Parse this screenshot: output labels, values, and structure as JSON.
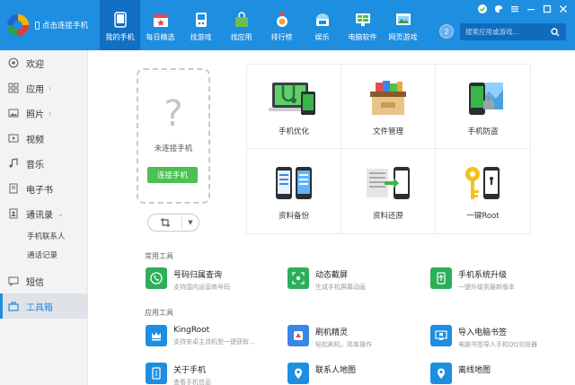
{
  "brand": {
    "label": "点击连接手机"
  },
  "nav": {
    "items": [
      {
        "label": "我的手机",
        "icon": "phone-icon"
      },
      {
        "label": "每日精选",
        "icon": "calendar-icon"
      },
      {
        "label": "找游戏",
        "icon": "gamepad-icon"
      },
      {
        "label": "找应用",
        "icon": "shopping-bag-icon"
      },
      {
        "label": "排行榜",
        "icon": "medal-icon"
      },
      {
        "label": "娱乐",
        "icon": "entertainment-icon"
      },
      {
        "label": "电脑软件",
        "icon": "monitor-icon"
      },
      {
        "label": "网页游戏",
        "icon": "web-game-icon"
      }
    ],
    "badge": "2"
  },
  "search": {
    "placeholder": "搜索应用或游戏..."
  },
  "sidebar": {
    "items": [
      {
        "label": "欢迎",
        "icon": "welcome-icon"
      },
      {
        "label": "应用",
        "icon": "apps-grid-icon"
      },
      {
        "label": "照片",
        "icon": "photo-icon"
      },
      {
        "label": "视频",
        "icon": "video-icon"
      },
      {
        "label": "音乐",
        "icon": "music-icon"
      },
      {
        "label": "电子书",
        "icon": "book-icon"
      },
      {
        "label": "通讯录",
        "icon": "contacts-icon"
      },
      {
        "label": "短信",
        "icon": "sms-icon"
      },
      {
        "label": "工具箱",
        "icon": "toolbox-icon"
      }
    ],
    "sub_items": [
      "手机联系人",
      "通话记录"
    ]
  },
  "device": {
    "status": "未连接手机",
    "connect_label": "连接手机"
  },
  "features": [
    {
      "label": "手机优化",
      "icon": "optimize-icon"
    },
    {
      "label": "文件管理",
      "icon": "file-manager-icon"
    },
    {
      "label": "手机防盗",
      "icon": "anti-theft-icon"
    },
    {
      "label": "资料备份",
      "icon": "backup-icon"
    },
    {
      "label": "资料还原",
      "icon": "restore-icon"
    },
    {
      "label": "一键Root",
      "icon": "root-key-icon"
    }
  ],
  "sections": {
    "common": "常用工具",
    "apps": "应用工具"
  },
  "common_tools": [
    {
      "name": "号码归属查询",
      "desc": "支持国内运营商号码",
      "color": "#2eae5a"
    },
    {
      "name": "动态截屏",
      "desc": "生成手机屏幕动画",
      "color": "#2eae5a"
    },
    {
      "name": "手机系统升级",
      "desc": "一键升级到最新版本",
      "color": "#2eae5a"
    }
  ],
  "app_tools": [
    {
      "name": "KingRoot",
      "desc": "支持安卓主流机型一键获取...",
      "color": "#1e8ee0"
    },
    {
      "name": "刷机精灵",
      "desc": "轻松刷机，简单操作",
      "color": "#3a87e8"
    },
    {
      "name": "导入电脑书签",
      "desc": "电脑书签导入手机QQ浏览器",
      "color": "#1e8ee0"
    },
    {
      "name": "关于手机",
      "desc": "查看手机信息",
      "color": "#1e8ee0"
    },
    {
      "name": "联系人地图",
      "desc": "",
      "color": "#1e8ee0"
    },
    {
      "name": "离线地图",
      "desc": "",
      "color": "#1e8ee0"
    }
  ],
  "colors": {
    "accent": "#1e8ee0",
    "nav_active": "#116fc4",
    "connect": "#4cc151"
  }
}
